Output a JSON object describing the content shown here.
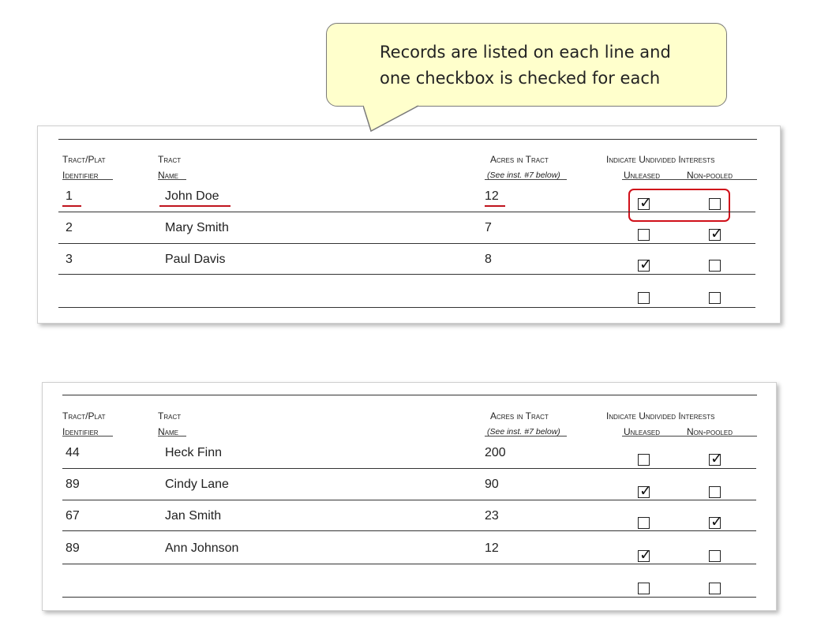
{
  "callout": {
    "line1": "Records are listed on each line and",
    "line2": "one checkbox is checked for each"
  },
  "form_header": {
    "tract_plat": "Tract/Plat",
    "identifier": "Identifier",
    "tract": "Tract",
    "name": "Name",
    "acres_in_tract": "Acres in Tract",
    "see_inst": "(See inst. #7 below)",
    "indicate_undivided": "Indicate Undivided Interests",
    "unleased": "Unleased",
    "non_pooled": "Non-pooled"
  },
  "colors": {
    "annotation_red": "#c0141e",
    "callout_fill": "#ffffcc"
  },
  "forms": [
    {
      "rows": [
        {
          "id": "1",
          "name": "John Doe",
          "acres": "12",
          "unleased": true,
          "non_pooled": false
        },
        {
          "id": "2",
          "name": "Mary Smith",
          "acres": "7",
          "unleased": false,
          "non_pooled": true
        },
        {
          "id": "3",
          "name": "Paul Davis",
          "acres": "8",
          "unleased": true,
          "non_pooled": false
        },
        {
          "id": "",
          "name": "",
          "acres": "",
          "unleased": false,
          "non_pooled": false
        }
      ]
    },
    {
      "rows": [
        {
          "id": "44",
          "name": "Heck Finn",
          "acres": "200",
          "unleased": false,
          "non_pooled": true
        },
        {
          "id": "89",
          "name": "Cindy Lane",
          "acres": "90",
          "unleased": true,
          "non_pooled": false
        },
        {
          "id": "67",
          "name": "Jan Smith",
          "acres": "23",
          "unleased": false,
          "non_pooled": true
        },
        {
          "id": "89",
          "name": "Ann Johnson",
          "acres": "12",
          "unleased": true,
          "non_pooled": false
        },
        {
          "id": "",
          "name": "",
          "acres": "",
          "unleased": false,
          "non_pooled": false
        }
      ]
    }
  ]
}
